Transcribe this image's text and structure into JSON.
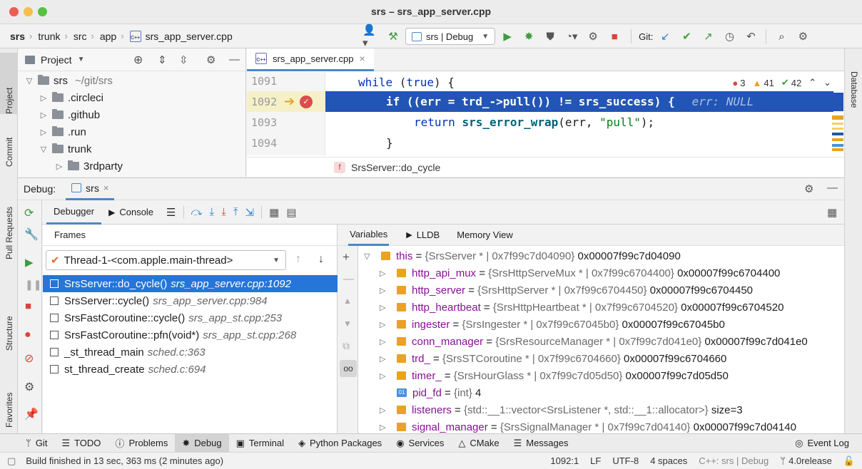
{
  "window": {
    "title": "srs – srs_app_server.cpp"
  },
  "breadcrumb": [
    "srs",
    "trunk",
    "src",
    "app",
    "srs_app_server.cpp"
  ],
  "toolbar": {
    "run_config": "srs | Debug",
    "git_label": "Git:"
  },
  "left_tabs": {
    "project": "Project",
    "commit": "Commit",
    "pull_requests": "Pull Requests",
    "structure": "Structure",
    "favorites": "Favorites"
  },
  "right_tabs": {
    "database": "Database"
  },
  "project_panel": {
    "title": "Project",
    "tree": [
      {
        "label": "srs",
        "extra": "~/git/srs",
        "open": true
      },
      {
        "label": ".circleci"
      },
      {
        "label": ".github"
      },
      {
        "label": ".run"
      },
      {
        "label": "trunk",
        "open": true
      },
      {
        "label": "3rdparty"
      }
    ]
  },
  "editor": {
    "tab": "srs_app_server.cpp",
    "line_numbers": [
      "1091",
      "1092",
      "1093",
      "1094"
    ],
    "code": {
      "l1_kw": "while",
      "l1_rest": " (",
      "l1_true": "true",
      "l1_end": ") {",
      "l2_kw": "if",
      "l2_a": " ((err = trd_->pull()) != ",
      "l2_b": "srs_success",
      "l2_c": ") {",
      "l2_hint": "err: NULL",
      "l3_kw": "return",
      "l3_fn": "srs_error_wrap",
      "l3_a": "(err, ",
      "l3_str": "\"pull\"",
      "l3_b": ");",
      "l4": "}"
    },
    "inspections": {
      "errors": "3",
      "warnings": "41",
      "ok": "42"
    },
    "breadcrumb": "SrsServer::do_cycle"
  },
  "debug": {
    "label": "Debug:",
    "session": "srs",
    "tabs": {
      "debugger": "Debugger",
      "console": "Console"
    },
    "frames_title": "Frames",
    "thread": "Thread-1-<com.apple.main-thread>",
    "frames": [
      {
        "fn": "SrsServer::do_cycle()",
        "file": "srs_app_server.cpp:1092"
      },
      {
        "fn": "SrsServer::cycle()",
        "file": "srs_app_server.cpp:984"
      },
      {
        "fn": "SrsFastCoroutine::cycle()",
        "file": "srs_app_st.cpp:253"
      },
      {
        "fn": "SrsFastCoroutine::pfn(void*)",
        "file": "srs_app_st.cpp:268"
      },
      {
        "fn": "_st_thread_main",
        "file": "sched.c:363"
      },
      {
        "fn": "st_thread_create",
        "file": "sched.c:694"
      }
    ],
    "var_tabs": {
      "variables": "Variables",
      "lldb": "LLDB",
      "memory": "Memory View"
    },
    "variables": [
      {
        "name": "this",
        "type": "{SrsServer * | 0x7f99c7d04090}",
        "value": "0x00007f99c7d04090"
      },
      {
        "name": "http_api_mux",
        "type": "{SrsHttpServeMux * | 0x7f99c6704400}",
        "value": "0x00007f99c6704400"
      },
      {
        "name": "http_server",
        "type": "{SrsHttpServer * | 0x7f99c6704450}",
        "value": "0x00007f99c6704450"
      },
      {
        "name": "http_heartbeat",
        "type": "{SrsHttpHeartbeat * | 0x7f99c6704520}",
        "value": "0x00007f99c6704520"
      },
      {
        "name": "ingester",
        "type": "{SrsIngester * | 0x7f99c67045b0}",
        "value": "0x00007f99c67045b0"
      },
      {
        "name": "conn_manager",
        "type": "{SrsResourceManager * | 0x7f99c7d041e0}",
        "value": "0x00007f99c7d041e0"
      },
      {
        "name": "trd_",
        "type": "{SrsSTCoroutine * | 0x7f99c6704660}",
        "value": "0x00007f99c6704660"
      },
      {
        "name": "timer_",
        "type": "{SrsHourGlass * | 0x7f99c7d05d50}",
        "value": "0x00007f99c7d05d50"
      },
      {
        "name": "pid_fd",
        "type": "{int}",
        "value": "4"
      },
      {
        "name": "listeners",
        "type": "{std::__1::vector<SrsListener *, std::__1::allocator>}",
        "value": "size=3"
      },
      {
        "name": "signal_manager",
        "type": "{SrsSignalManager * | 0x7f99c7d04140}",
        "value": "0x00007f99c7d04140"
      }
    ]
  },
  "tool_windows": [
    "Git",
    "TODO",
    "Problems",
    "Debug",
    "Terminal",
    "Python Packages",
    "Services",
    "CMake",
    "Messages",
    "Event Log"
  ],
  "status": {
    "message": "Build finished in 13 sec, 363 ms (2 minutes ago)",
    "position": "1092:1",
    "line_sep": "LF",
    "encoding": "UTF-8",
    "indent": "4 spaces",
    "context": "C++: srs | Debug",
    "branch": "4.0release"
  }
}
